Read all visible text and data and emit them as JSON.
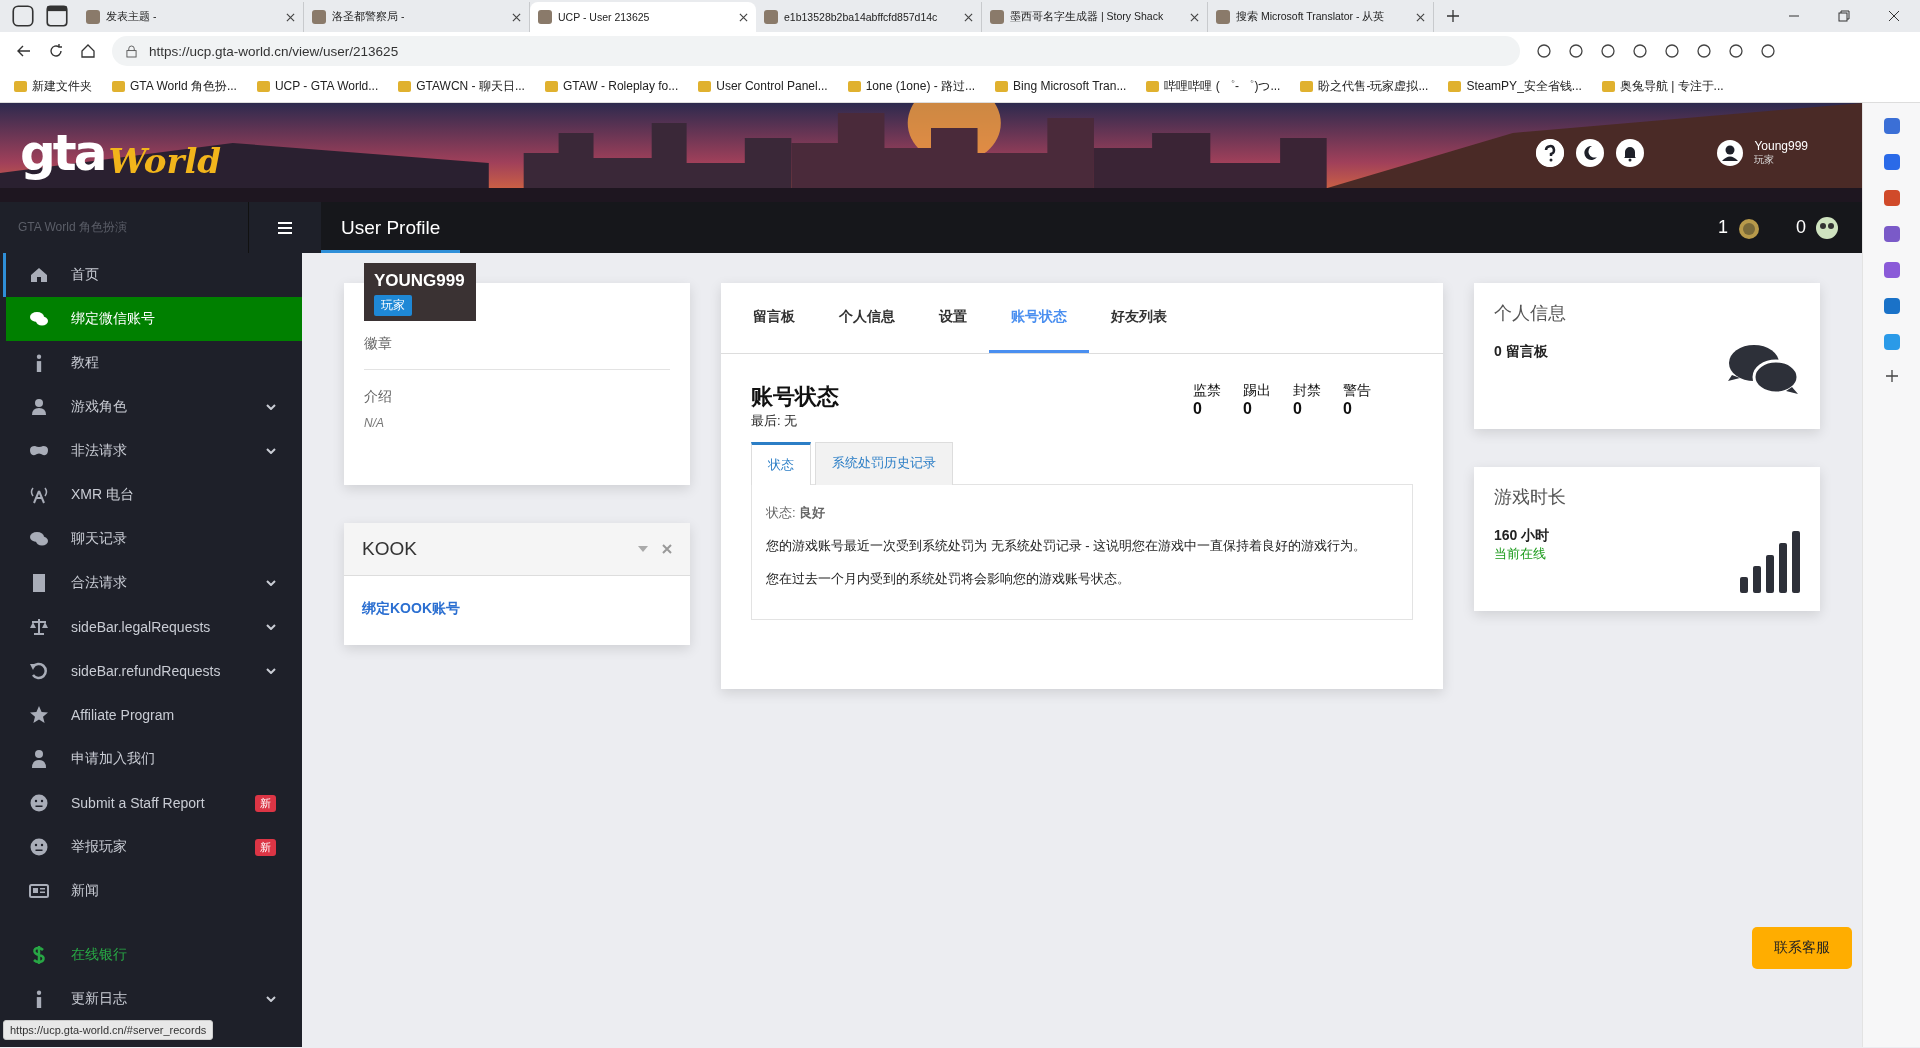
{
  "browser": {
    "tabs": [
      {
        "title": "发表主题 -",
        "selected": false
      },
      {
        "title": "洛圣都警察局 -",
        "selected": false
      },
      {
        "title": "UCP - User 213625",
        "selected": true
      },
      {
        "title": "e1b13528b2ba14abffcfd857d14c",
        "selected": false
      },
      {
        "title": "墨西哥名字生成器 | Story Shack",
        "selected": false
      },
      {
        "title": "搜索 Microsoft Translator - 从英",
        "selected": false
      }
    ],
    "url": "https://ucp.gta-world.cn/view/user/213625",
    "bookmarks": [
      "新建文件夹",
      "GTA World 角色扮...",
      "UCP - GTA World...",
      "GTAWCN - 聊天日...",
      "GTAW - Roleplay fo...",
      "User Control Panel...",
      "1one (1one) - 路过...",
      "Bing Microsoft Tran...",
      "哔哩哔哩 ( ゜- ゜)つ...",
      "盼之代售-玩家虚拟...",
      "SteamPY_安全省钱...",
      "奥兔导航 | 专注于..."
    ],
    "status_url": "https://ucp.gta-world.cn/#server_records"
  },
  "header": {
    "logo_top": "gta",
    "logo_bottom": "World",
    "user": {
      "name": "Young999",
      "role": "玩家"
    }
  },
  "topbar": {
    "site_name": "GTA World 角色扮演",
    "page_title": "User Profile",
    "counters": [
      {
        "value": "1"
      },
      {
        "value": "0"
      }
    ]
  },
  "sidebar": {
    "items": [
      {
        "label": "首页",
        "selected": false,
        "has_submenu": false
      },
      {
        "label": "绑定微信账号",
        "selected": true,
        "has_submenu": false
      },
      {
        "label": "教程",
        "selected": false,
        "has_submenu": false
      },
      {
        "label": "游戏角色",
        "selected": false,
        "has_submenu": true
      },
      {
        "label": "非法请求",
        "selected": false,
        "has_submenu": true
      },
      {
        "label": "XMR 电台",
        "selected": false,
        "has_submenu": false
      },
      {
        "label": "聊天记录",
        "selected": false,
        "has_submenu": false
      },
      {
        "label": "合法请求",
        "selected": false,
        "has_submenu": true
      },
      {
        "label": "sideBar.legalRequests",
        "selected": false,
        "has_submenu": true
      },
      {
        "label": "sideBar.refundRequests",
        "selected": false,
        "has_submenu": true
      },
      {
        "label": "Affiliate Program",
        "selected": false,
        "has_submenu": false
      },
      {
        "label": "申请加入我们",
        "selected": false,
        "has_submenu": false
      },
      {
        "label": "Submit a Staff Report",
        "selected": false,
        "has_submenu": false,
        "badge": "新"
      },
      {
        "label": "举报玩家",
        "selected": false,
        "has_submenu": false,
        "badge": "新"
      },
      {
        "label": "新闻",
        "selected": false,
        "has_submenu": false
      },
      {
        "label": "在线银行",
        "selected": false,
        "has_submenu": false,
        "color": "#28a745"
      },
      {
        "label": "更新日志",
        "selected": false,
        "has_submenu": true
      }
    ]
  },
  "profile": {
    "name": "YOUNG999",
    "role": "玩家",
    "badges_label": "徽章",
    "intro_label": "介绍",
    "intro_value": "N/A"
  },
  "kook": {
    "title": "KOOK",
    "link": "绑定KOOK账号"
  },
  "main": {
    "tabs": [
      {
        "label": "留言板",
        "selected": false
      },
      {
        "label": "个人信息",
        "selected": false
      },
      {
        "label": "设置",
        "selected": false
      },
      {
        "label": "账号状态",
        "selected": true
      },
      {
        "label": "好友列表",
        "selected": false
      }
    ],
    "title": "账号状态",
    "last": "最后: 无",
    "stats": [
      {
        "label": "监禁",
        "value": "0"
      },
      {
        "label": "踢出",
        "value": "0"
      },
      {
        "label": "封禁",
        "value": "0"
      },
      {
        "label": "警告",
        "value": "0"
      }
    ],
    "subtabs": [
      {
        "label": "状态",
        "selected": true
      },
      {
        "label": "系统处罚历史记录",
        "selected": false
      }
    ],
    "status_line": "状态: **良好**",
    "paragraphs": [
      "您的游戏账号最近一次受到系统处罚为 无系统处罚记录 - 这说明您在游戏中一直保持着良好的游戏行为。",
      "您在过去一个月内受到的系统处罚将会影响您的游戏账号状态。"
    ]
  },
  "info_cards": [
    {
      "title": "个人信息",
      "value": "0 留言板",
      "kind": "chat"
    },
    {
      "title": "游戏时长",
      "value": "160 小时",
      "note": "当前在线",
      "kind": "bars"
    }
  ],
  "contact_button": "联系客服"
}
